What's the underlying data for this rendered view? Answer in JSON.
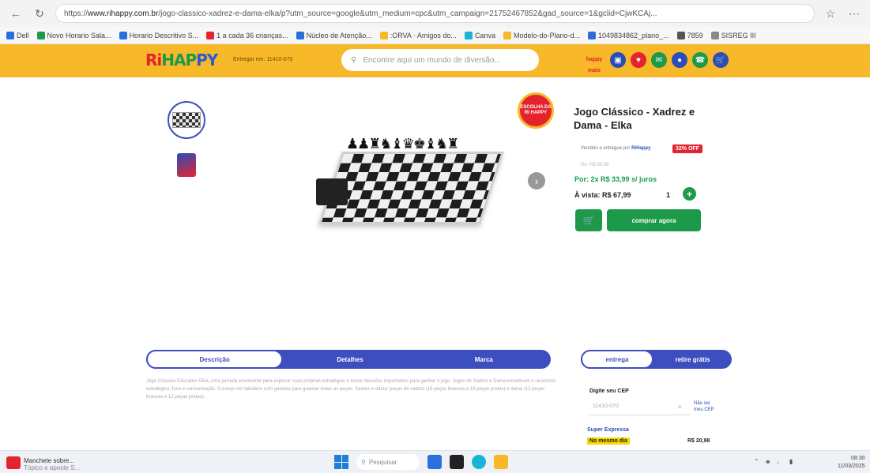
{
  "browser": {
    "url_prefix": "https://",
    "url_domain": "www.rihappy.com.br",
    "url_path": "/jogo-classico-xadrez-e-dama-elka/p?utm_source=google&utm_medium=cpc&utm_campaign=21752467852&gad_source=1&gclid=CjwKCAj...",
    "bookmarks": [
      {
        "label": "Dell",
        "color": "#2a6fdb"
      },
      {
        "label": "Novo Horario Sala...",
        "color": "#1c9a4a"
      },
      {
        "label": "Horario Descritivo S...",
        "color": "#2a6fdb"
      },
      {
        "label": "1 a cada 36 crianças...",
        "color": "#e4232f"
      },
      {
        "label": "Núcleo de Atenção...",
        "color": "#2a6fdb"
      },
      {
        "label": ":ORVA · Amigos do...",
        "color": "#f7b82a"
      },
      {
        "label": "Canva",
        "color": "#18b4d8"
      },
      {
        "label": "Modelo-do-Plano-d...",
        "color": "#f7b82a"
      },
      {
        "label": "1049834862_plano_...",
        "color": "#2a6fdb"
      },
      {
        "label": "7859",
        "color": "#555555"
      },
      {
        "label": "SISREG III",
        "color": "#888888"
      }
    ]
  },
  "header": {
    "logo": {
      "ri": "Ri",
      "hap": "HAP",
      "py": "PY"
    },
    "cep_label": "Entregar em: 11410-070",
    "search_placeholder": "Encontre aqui um mundo de diversão...",
    "brand_small": "happy mais"
  },
  "product": {
    "seal_text": "ESCOLHA DA RI HAPPY",
    "title": "Jogo Clássico - Xadrez e Dama - Elka",
    "seller_prefix": "Vendido e entregue por",
    "seller_name": "RiHappy",
    "discount": "32% OFF",
    "old_price": "De: R$ 99,99",
    "installments": "Por: 2x R$ 33,99 s/ juros",
    "cash_price": "À vista: R$ 67,99",
    "quantity": "1",
    "buy_label": "comprar agora",
    "description": "Jogo Clássico Educativo Elka, uma jornada envolvente para explorar suas próprias estratégias e tomar decisões importantes para ganhar o jogo. Jogos de Xadrez e Dama incentivam o raciocínio estratégico, foco e concentração. O estojo em tabuleiro com gavetas para guardar todas as peças. Xadrez e dama: peças de xadrez (16 peças brancas e 16 peças pretas) e dama (12 peças brancas e 12 peças pretas)."
  },
  "tabs": [
    "Descrição",
    "Detalhes",
    "Marca"
  ],
  "delivery": {
    "tabs": [
      "entrega",
      "retire grátis"
    ],
    "cep_title": "Digite seu CEP",
    "cep_value": "11410-070",
    "cep_link": "Não sei meu CEP",
    "express": "Super Expressa",
    "same_day": "No mesmo dia",
    "price": "R$ 20,98"
  },
  "taskbar": {
    "news_title": "Manchete sobre...",
    "news_sub": "Tópico e aposte S...",
    "search": "Pesquisar",
    "time": "08:30",
    "date": "11/03/2025"
  }
}
